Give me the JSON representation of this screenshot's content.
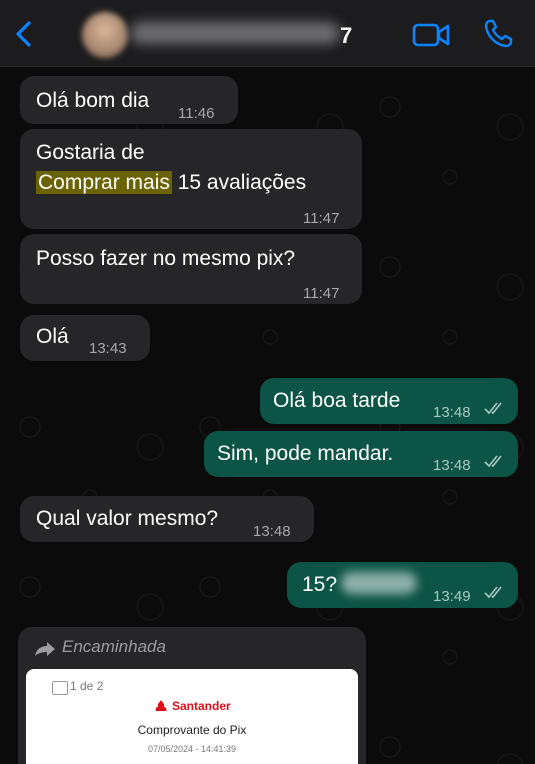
{
  "header": {
    "contact_suffix": "7",
    "icons": {
      "back": "chevron-left-icon",
      "video": "video-camera-icon",
      "call": "phone-icon"
    },
    "accent": "#0a84ff"
  },
  "messages": [
    {
      "from": "contact",
      "text": "Olá bom dia",
      "time": "11:46"
    },
    {
      "from": "contact",
      "lines": [
        "Gostaria de",
        "Comprar mais",
        " 15 avaliações"
      ],
      "highlight": "Comprar mais",
      "time": "11:47"
    },
    {
      "from": "contact",
      "text": "Posso fazer no mesmo pix?",
      "time": "11:47"
    },
    {
      "from": "contact",
      "text": "Olá",
      "time": "13:43"
    },
    {
      "from": "me",
      "text": "Olá boa tarde",
      "time": "13:48",
      "status": "read"
    },
    {
      "from": "me",
      "text": "Sim, pode mandar.",
      "time": "13:48",
      "status": "read"
    },
    {
      "from": "contact",
      "text": "Qual valor mesmo?",
      "time": "13:48"
    },
    {
      "from": "me",
      "text": "15?",
      "time": "13:49",
      "status": "read"
    }
  ],
  "forwarded": {
    "label": "Encaminhada",
    "doc_page": "1 de 2",
    "bank": "Santander",
    "title": "Comprovante do Pix",
    "date": "07/05/2024 - 14:41:39"
  },
  "colors": {
    "incoming_bubble": "#262628",
    "outgoing_bubble": "#0c5445",
    "highlight": "#6b6200",
    "santander_red": "#e20d18"
  }
}
